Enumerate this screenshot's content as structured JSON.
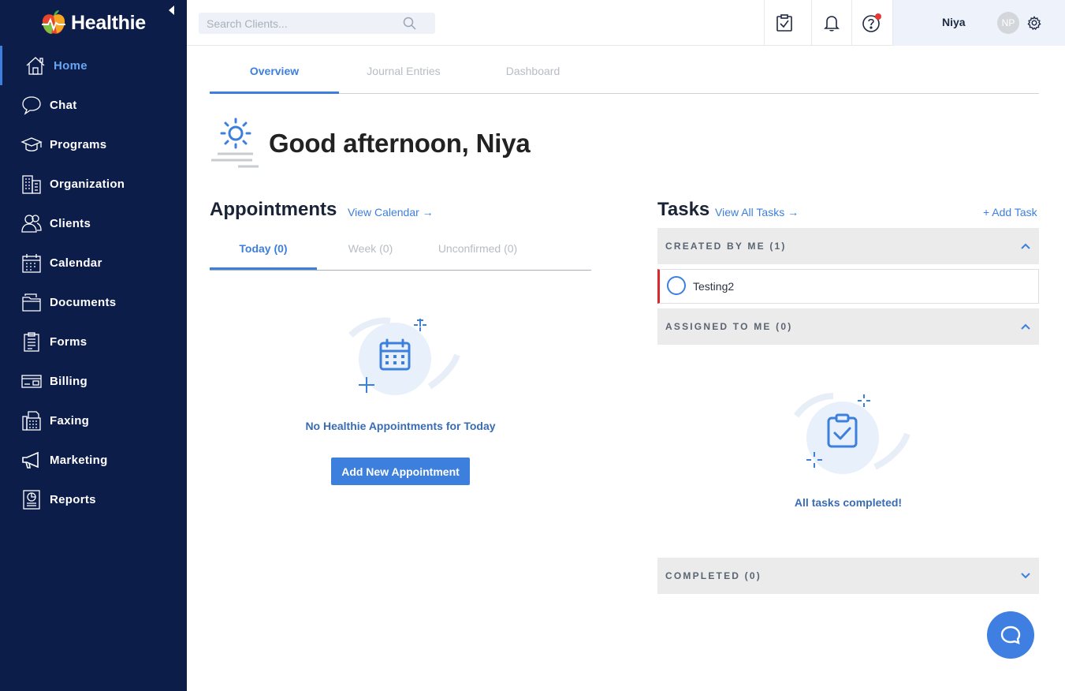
{
  "app": {
    "name": "Healthie"
  },
  "sidebar": {
    "items": [
      {
        "label": "Home",
        "icon": "home-icon"
      },
      {
        "label": "Chat",
        "icon": "chat-icon"
      },
      {
        "label": "Programs",
        "icon": "graduation-cap-icon"
      },
      {
        "label": "Organization",
        "icon": "building-icon"
      },
      {
        "label": "Clients",
        "icon": "users-icon"
      },
      {
        "label": "Calendar",
        "icon": "calendar-icon"
      },
      {
        "label": "Documents",
        "icon": "folder-icon"
      },
      {
        "label": "Forms",
        "icon": "clipboard-icon"
      },
      {
        "label": "Billing",
        "icon": "credit-card-icon"
      },
      {
        "label": "Faxing",
        "icon": "fax-icon"
      },
      {
        "label": "Marketing",
        "icon": "megaphone-icon"
      },
      {
        "label": "Reports",
        "icon": "report-icon"
      }
    ],
    "active": "Home"
  },
  "topbar": {
    "search_placeholder": "Search Clients...",
    "user_name": "Niya",
    "user_initials": "NP"
  },
  "main_tabs": [
    "Overview",
    "Journal Entries",
    "Dashboard"
  ],
  "greeting": "Good afternoon, Niya",
  "appointments": {
    "title": "Appointments",
    "view_link": "View Calendar →",
    "tabs": [
      "Today (0)",
      "Week (0)",
      "Unconfirmed (0)"
    ],
    "empty_text": "No Healthie Appointments for Today",
    "add_button": "Add New Appointment"
  },
  "tasks": {
    "title": "Tasks",
    "view_link": "View All Tasks →",
    "add_link": "+ Add Task",
    "groups": {
      "created": "CREATED BY ME (1)",
      "assigned": "ASSIGNED TO ME (0)",
      "completed": "COMPLETED (0)"
    },
    "items": [
      {
        "name": "Testing2"
      }
    ],
    "empty_text": "All tasks completed!"
  },
  "colors": {
    "sidebar_bg": "#0c1d4a",
    "accent": "#3d7fdd",
    "task_flag": "#d8282e",
    "notification_dot": "#e53935"
  }
}
